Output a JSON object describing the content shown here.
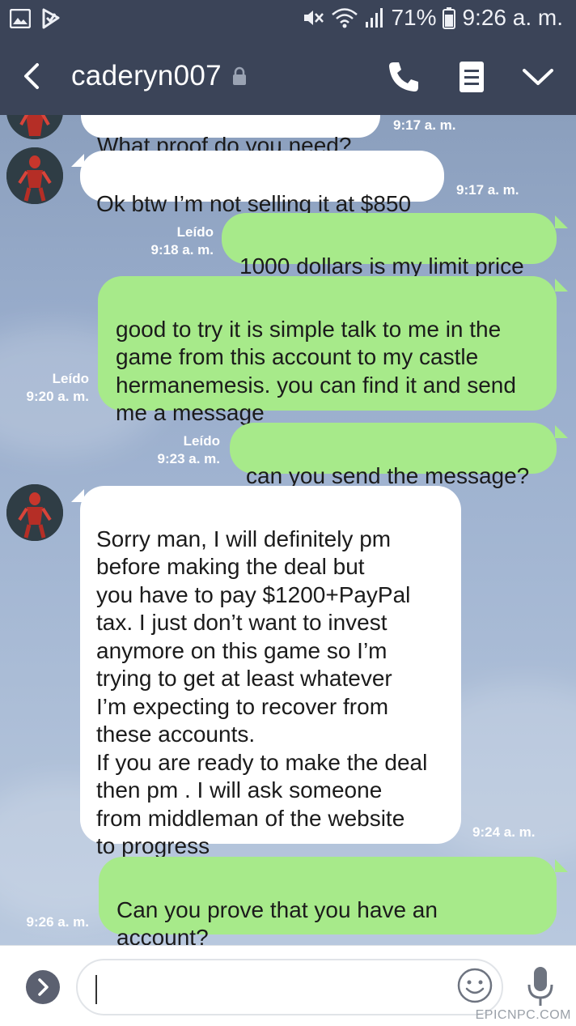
{
  "status_bar": {
    "battery": "71%",
    "time": "9:26 a. m."
  },
  "header": {
    "contact_name": "caderyn007"
  },
  "messages": [
    {
      "dir": "in",
      "text": "What proof do you need?",
      "time": "9:17 a. m."
    },
    {
      "dir": "in",
      "text": "Ok btw I’m not selling it at $850",
      "time": "9:17 a. m."
    },
    {
      "dir": "out",
      "read": "Leído",
      "time": "9:18 a. m.",
      "text": "1000 dollars is my limit price"
    },
    {
      "dir": "out",
      "read": "Leído",
      "time": "9:20 a. m.",
      "text": "good to try it is simple talk to me in the\ngame from this account to my castle\nhermanemesis. you can find it and send\nme a message"
    },
    {
      "dir": "out",
      "read": "Leído",
      "time": "9:23 a. m.",
      "text": "can you send the message?"
    },
    {
      "dir": "in",
      "text": "Sorry man, I will definitely pm\nbefore making the deal but\nyou have to pay $1200+PayPal\ntax. I just don’t want to invest\nanymore on this game so I’m\ntrying to get at least whatever\nI’m expecting to recover from\nthese accounts.\nIf you are ready to make the deal\nthen pm . I will ask someone\nfrom middleman of the website\nto progress",
      "time": "9:24 a. m."
    },
    {
      "dir": "out",
      "time": "9:26 a. m.",
      "text": "Can you prove that you have an\naccount?"
    }
  ],
  "input": {
    "value": ""
  },
  "watermark": "EPICNPC.COM",
  "icons": [
    "gallery-icon",
    "check-flag-icon",
    "mute-icon",
    "wifi-icon",
    "signal-icon",
    "battery-icon",
    "back-arrow-icon",
    "lock-icon",
    "phone-icon",
    "menu-icon",
    "chevron-down-icon",
    "chevron-right-icon",
    "emoji-icon",
    "mic-icon"
  ],
  "colors": {
    "header": "#3b4458",
    "bubble_out": "#a7ea8a",
    "bubble_in": "#ffffff",
    "chat_bg": "#98accb"
  }
}
